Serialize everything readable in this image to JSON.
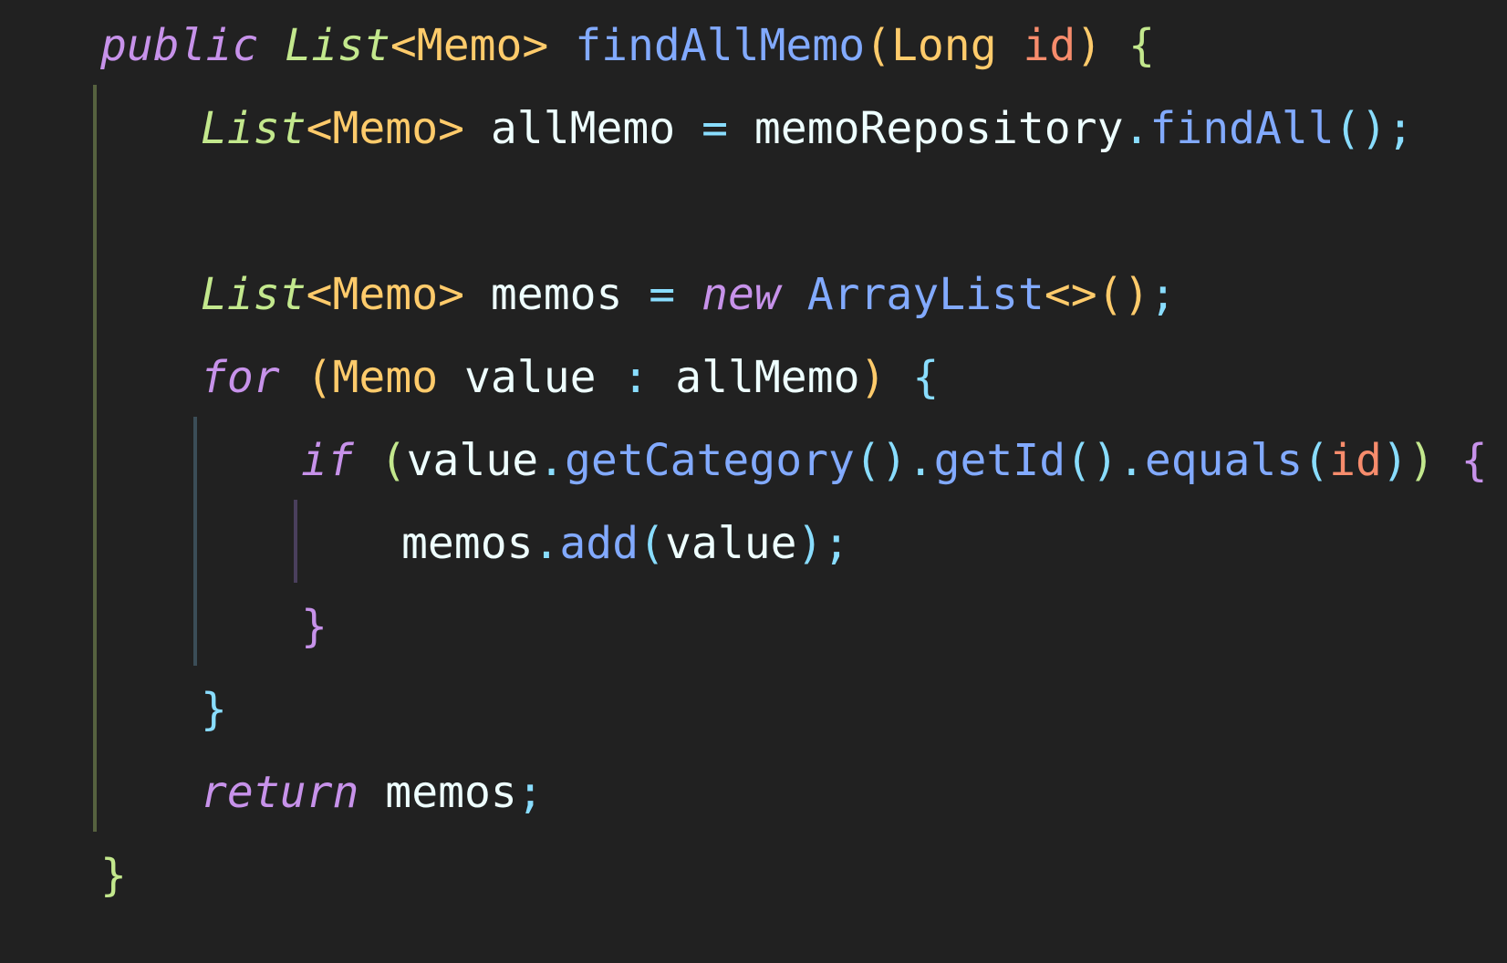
{
  "editor": {
    "background": "#212121",
    "indent_guide_colors": [
      "#56623F",
      "#3B4D57",
      "#4A3F5C"
    ],
    "lines": [
      {
        "indent": 0,
        "tokens": [
          {
            "text": "public",
            "color": "#C792EA",
            "italic": true
          },
          {
            "text": " ",
            "color": "#EEFFFF"
          },
          {
            "text": "List",
            "color": "#C3E88D",
            "italic": true
          },
          {
            "text": "<",
            "color": "#FFCB6B"
          },
          {
            "text": "Memo",
            "color": "#FFCB6B"
          },
          {
            "text": ">",
            "color": "#FFCB6B"
          },
          {
            "text": " ",
            "color": "#EEFFFF"
          },
          {
            "text": "findAllMemo",
            "color": "#82AAFF"
          },
          {
            "text": "(",
            "color": "#FFCB6B"
          },
          {
            "text": "Long",
            "color": "#FFCB6B"
          },
          {
            "text": " ",
            "color": "#EEFFFF"
          },
          {
            "text": "id",
            "color": "#F78C6C"
          },
          {
            "text": ")",
            "color": "#FFCB6B"
          },
          {
            "text": " ",
            "color": "#EEFFFF"
          },
          {
            "text": "{",
            "color": "#C3E88D"
          }
        ]
      },
      {
        "indent": 1,
        "tokens": [
          {
            "text": "List",
            "color": "#C3E88D",
            "italic": true
          },
          {
            "text": "<",
            "color": "#FFCB6B"
          },
          {
            "text": "Memo",
            "color": "#FFCB6B"
          },
          {
            "text": ">",
            "color": "#FFCB6B"
          },
          {
            "text": " allMemo ",
            "color": "#EEFFFF"
          },
          {
            "text": "=",
            "color": "#89DDFF"
          },
          {
            "text": " memoRepository",
            "color": "#EEFFFF"
          },
          {
            "text": ".",
            "color": "#89DDFF"
          },
          {
            "text": "findAll",
            "color": "#82AAFF"
          },
          {
            "text": "()",
            "color": "#89DDFF"
          },
          {
            "text": ";",
            "color": "#89DDFF"
          }
        ]
      },
      {
        "indent": 1,
        "tokens": []
      },
      {
        "indent": 1,
        "tokens": [
          {
            "text": "List",
            "color": "#C3E88D",
            "italic": true
          },
          {
            "text": "<",
            "color": "#FFCB6B"
          },
          {
            "text": "Memo",
            "color": "#FFCB6B"
          },
          {
            "text": ">",
            "color": "#FFCB6B"
          },
          {
            "text": " memos ",
            "color": "#EEFFFF"
          },
          {
            "text": "=",
            "color": "#89DDFF"
          },
          {
            "text": " ",
            "color": "#EEFFFF"
          },
          {
            "text": "new",
            "color": "#C792EA",
            "italic": true
          },
          {
            "text": " ",
            "color": "#EEFFFF"
          },
          {
            "text": "ArrayList",
            "color": "#82AAFF"
          },
          {
            "text": "<>",
            "color": "#FFCB6B"
          },
          {
            "text": "()",
            "color": "#FFCB6B"
          },
          {
            "text": ";",
            "color": "#89DDFF"
          }
        ]
      },
      {
        "indent": 1,
        "tokens": [
          {
            "text": "for",
            "color": "#C792EA",
            "italic": true
          },
          {
            "text": " ",
            "color": "#EEFFFF"
          },
          {
            "text": "(",
            "color": "#FFCB6B"
          },
          {
            "text": "Memo",
            "color": "#FFCB6B"
          },
          {
            "text": " value ",
            "color": "#EEFFFF"
          },
          {
            "text": ":",
            "color": "#89DDFF"
          },
          {
            "text": " allMemo",
            "color": "#EEFFFF"
          },
          {
            "text": ")",
            "color": "#FFCB6B"
          },
          {
            "text": " ",
            "color": "#EEFFFF"
          },
          {
            "text": "{",
            "color": "#89DDFF"
          }
        ]
      },
      {
        "indent": 2,
        "tokens": [
          {
            "text": "if",
            "color": "#C792EA",
            "italic": true
          },
          {
            "text": " ",
            "color": "#EEFFFF"
          },
          {
            "text": "(",
            "color": "#C3E88D"
          },
          {
            "text": "value",
            "color": "#EEFFFF"
          },
          {
            "text": ".",
            "color": "#89DDFF"
          },
          {
            "text": "getCategory",
            "color": "#82AAFF"
          },
          {
            "text": "()",
            "color": "#89DDFF"
          },
          {
            "text": ".",
            "color": "#89DDFF"
          },
          {
            "text": "getId",
            "color": "#82AAFF"
          },
          {
            "text": "()",
            "color": "#89DDFF"
          },
          {
            "text": ".",
            "color": "#89DDFF"
          },
          {
            "text": "equals",
            "color": "#82AAFF"
          },
          {
            "text": "(",
            "color": "#89DDFF"
          },
          {
            "text": "id",
            "color": "#F78C6C"
          },
          {
            "text": ")",
            "color": "#89DDFF"
          },
          {
            "text": ")",
            "color": "#C3E88D"
          },
          {
            "text": " ",
            "color": "#EEFFFF"
          },
          {
            "text": "{",
            "color": "#C792EA"
          }
        ]
      },
      {
        "indent": 3,
        "tokens": [
          {
            "text": "memos",
            "color": "#EEFFFF"
          },
          {
            "text": ".",
            "color": "#89DDFF"
          },
          {
            "text": "add",
            "color": "#82AAFF"
          },
          {
            "text": "(",
            "color": "#89DDFF"
          },
          {
            "text": "value",
            "color": "#EEFFFF"
          },
          {
            "text": ")",
            "color": "#89DDFF"
          },
          {
            "text": ";",
            "color": "#89DDFF"
          }
        ]
      },
      {
        "indent": 2,
        "tokens": [
          {
            "text": "}",
            "color": "#C792EA"
          }
        ]
      },
      {
        "indent": 1,
        "tokens": [
          {
            "text": "}",
            "color": "#89DDFF"
          }
        ]
      },
      {
        "indent": 1,
        "tokens": [
          {
            "text": "return",
            "color": "#C792EA",
            "italic": true
          },
          {
            "text": " memos",
            "color": "#EEFFFF"
          },
          {
            "text": ";",
            "color": "#89DDFF"
          }
        ]
      },
      {
        "indent": 0,
        "tokens": [
          {
            "text": "}",
            "color": "#C3E88D"
          }
        ]
      }
    ]
  }
}
